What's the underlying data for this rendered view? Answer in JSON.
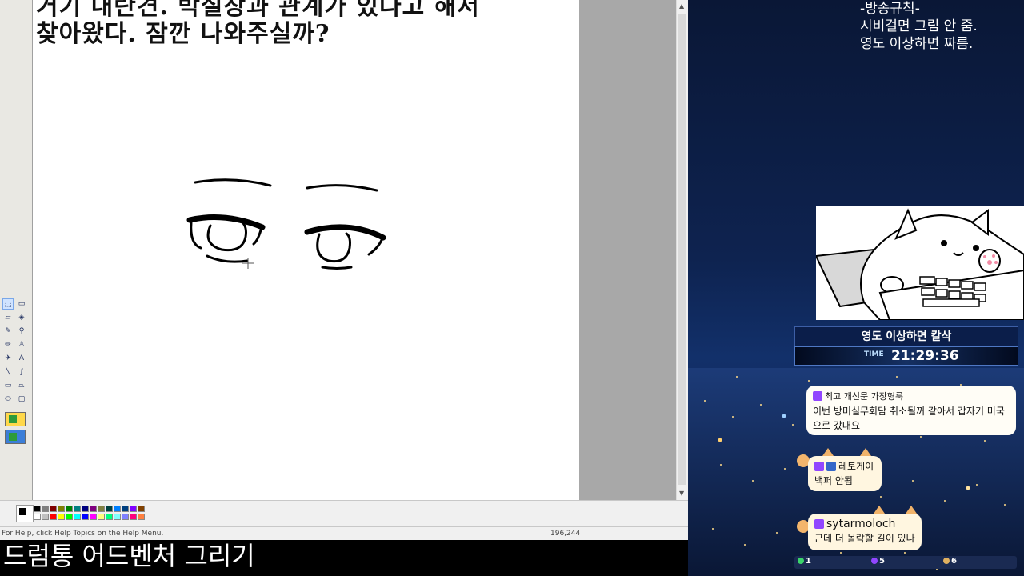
{
  "paint": {
    "canvas_text_line1": "거기 내란견. 박실장과 관계가 있다고 해서",
    "canvas_text_line2": "찾아왔다. 잠깐 나와주실까?",
    "status_help": "For Help, click Help Topics on the Help Menu.",
    "status_coords": "196,244",
    "palette_colors": [
      "#000000",
      "#808080",
      "#800000",
      "#808000",
      "#008000",
      "#008080",
      "#000080",
      "#800080",
      "#808040",
      "#004040",
      "#0080ff",
      "#004080",
      "#8000ff",
      "#804000",
      "#ffffff",
      "#c0c0c0",
      "#ff0000",
      "#ffff00",
      "#00ff00",
      "#00ffff",
      "#0000ff",
      "#ff00ff",
      "#ffff80",
      "#00ff80",
      "#80ffff",
      "#8080ff",
      "#ff0080",
      "#ff8040"
    ]
  },
  "caption": "드럼통 어드벤처 그리기",
  "overlay": {
    "rules_title": "-방송규칙-",
    "rules_line1": "시비걸면 그림 안 줌.",
    "rules_line2": "영도 이상하면 짜름.",
    "warning": "영도 이상하면 칼삭",
    "time_label": "TIME",
    "time_value": "21:29:36",
    "chat": [
      {
        "name": "최고 개선문 가장형룩",
        "message": "이번 방미실무회담 취소될꺼 같아서 갑자기 미국으로 갔대요"
      },
      {
        "name": "레토게이",
        "message": "백퍼 안됨"
      },
      {
        "name": "sytarmoloch",
        "message": "근데 더 몰락할 길이 있나"
      }
    ],
    "stats": [
      "1",
      "5",
      "6"
    ]
  }
}
